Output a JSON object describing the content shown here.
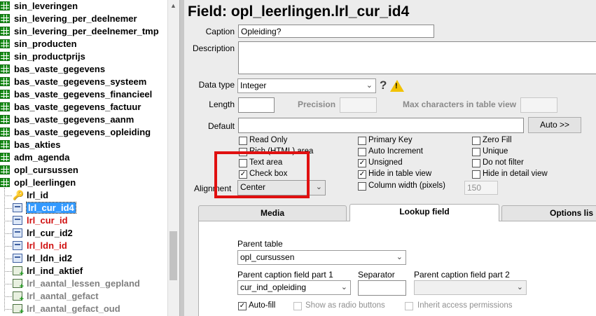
{
  "tree": {
    "items": [
      {
        "label": "sin_leveringen",
        "icon": "table-icon"
      },
      {
        "label": "sin_levering_per_deelnemer",
        "icon": "table-icon"
      },
      {
        "label": "sin_levering_per_deelnemer_tmp",
        "icon": "table-icon"
      },
      {
        "label": "sin_producten",
        "icon": "table-icon"
      },
      {
        "label": "sin_productprijs",
        "icon": "table-icon"
      },
      {
        "label": "bas_vaste_gegevens",
        "icon": "table-icon"
      },
      {
        "label": "bas_vaste_gegevens_systeem",
        "icon": "table-icon"
      },
      {
        "label": "bas_vaste_gegevens_financieel",
        "icon": "table-icon"
      },
      {
        "label": "bas_vaste_gegevens_factuur",
        "icon": "table-icon"
      },
      {
        "label": "bas_vaste_gegevens_aanm",
        "icon": "table-icon"
      },
      {
        "label": "bas_vaste_gegevens_opleiding",
        "icon": "table-icon"
      },
      {
        "label": "bas_akties",
        "icon": "table-icon"
      },
      {
        "label": "adm_agenda",
        "icon": "table-icon"
      },
      {
        "label": "opl_cursussen",
        "icon": "table-icon"
      },
      {
        "label": "opl_leerlingen",
        "icon": "table-icon"
      },
      {
        "label": "lrl_id",
        "icon": "key-icon"
      },
      {
        "label": "lrl_cur_id4",
        "icon": "field-icon"
      },
      {
        "label": "lrl_cur_id",
        "icon": "field-icon"
      },
      {
        "label": "lrl_cur_id2",
        "icon": "field-icon"
      },
      {
        "label": "lrl_ldn_id",
        "icon": "field-icon"
      },
      {
        "label": "lrl_ldn_id2",
        "icon": "field-icon"
      },
      {
        "label": "lrl_ind_aktief",
        "icon": "calculated-field-icon"
      },
      {
        "label": "lrl_aantal_lessen_gepland",
        "icon": "calculated-field-icon"
      },
      {
        "label": "lrl_aantal_gefact",
        "icon": "calculated-field-icon"
      },
      {
        "label": "lrl_aantal_gefact_oud",
        "icon": "calculated-field-icon"
      }
    ]
  },
  "field": {
    "title": "Field: opl_leerlingen.lrl_cur_id4",
    "caption_label": "Caption",
    "caption_value": "Opleiding?",
    "description_label": "Description",
    "description_value": "",
    "datatype_label": "Data type",
    "datatype_value": "Integer",
    "help_glyph": "?",
    "warn_glyph": "!",
    "length_label": "Length",
    "precision_label": "Precision",
    "maxchars_label": "Max characters in table view",
    "default_label": "Default",
    "auto_button": "Auto >>",
    "alignment_label": "Alignment",
    "alignment_value": "Center",
    "column_width_value": "150"
  },
  "checkboxes": {
    "read_only": {
      "label": "Read Only",
      "checked": false
    },
    "rich_html": {
      "label": "Rich (HTML) area",
      "checked": false
    },
    "text_area": {
      "label": "Text area",
      "checked": false
    },
    "check_box": {
      "label": "Check box",
      "checked": true
    },
    "primary_key": {
      "label": "Primary Key",
      "checked": false
    },
    "auto_increment": {
      "label": "Auto Increment",
      "checked": false
    },
    "unsigned": {
      "label": "Unsigned",
      "checked": true
    },
    "hide_table": {
      "label": "Hide in table view",
      "checked": true
    },
    "column_width": {
      "label": "Column width (pixels)",
      "checked": false
    },
    "zero_fill": {
      "label": "Zero Fill",
      "checked": false
    },
    "unique": {
      "label": "Unique",
      "checked": false
    },
    "no_filter": {
      "label": "Do not filter",
      "checked": false
    },
    "hide_detail": {
      "label": "Hide in detail view",
      "checked": false
    }
  },
  "tabs": [
    {
      "label": "Media",
      "active": false
    },
    {
      "label": "Lookup field",
      "active": true
    },
    {
      "label": "Options lis",
      "active": false
    }
  ],
  "lookup": {
    "parent_table_label": "Parent table",
    "parent_table_value": "opl_cursussen",
    "caption1_label": "Parent caption field part 1",
    "caption1_value": "cur_ind_opleiding",
    "separator_label": "Separator",
    "separator_value": "",
    "caption2_label": "Parent caption field part 2",
    "caption2_value": "",
    "autofill": {
      "label": "Auto-fill",
      "checked": true
    },
    "radio": {
      "label": "Show as radio buttons",
      "checked": false
    },
    "inherit": {
      "label": "Inherit access permissions",
      "checked": false
    }
  },
  "colors": {
    "highlight": "#e01010",
    "selection": "#3399ff"
  }
}
